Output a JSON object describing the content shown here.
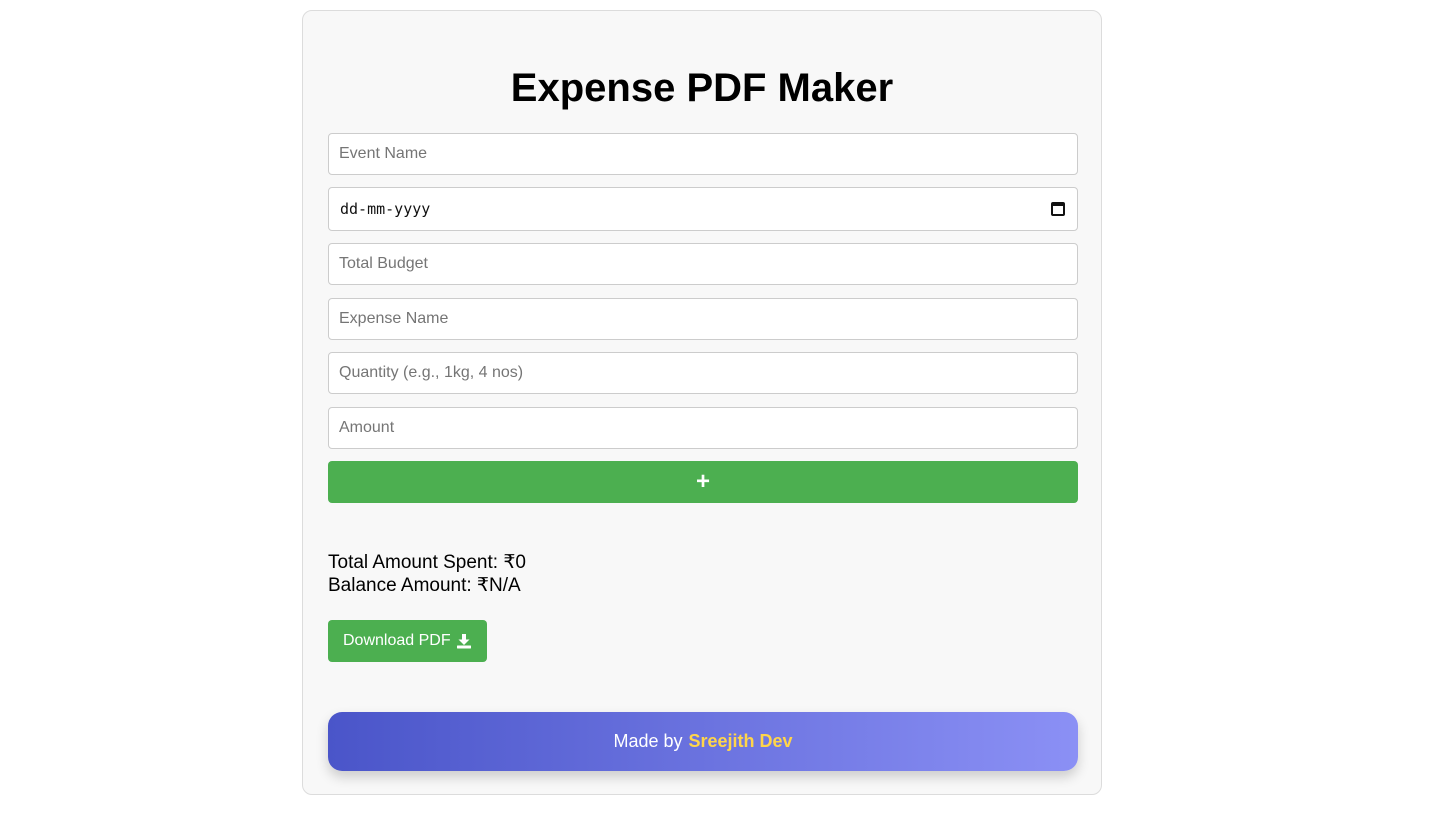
{
  "app": {
    "title": "Expense PDF Maker"
  },
  "form": {
    "event_name_placeholder": "Event Name",
    "date_placeholder": "dd-mm-yyyy",
    "total_budget_placeholder": "Total Budget",
    "expense_name_placeholder": "Expense Name",
    "quantity_placeholder": "Quantity (e.g., 1kg, 4 nos)",
    "amount_placeholder": "Amount",
    "add_button_label": "+"
  },
  "summary": {
    "total_spent": "Total Amount Spent: ₹0",
    "balance": "Balance Amount: ₹N/A"
  },
  "download": {
    "label": "Download PDF",
    "icon": "download-icon"
  },
  "footer": {
    "made_by": "Made by",
    "author": "Sreejith Dev"
  },
  "colors": {
    "accent_green": "#4caf50",
    "footer_gradient_start": "#4a55c9",
    "footer_gradient_end": "#8b90f5",
    "author_yellow": "#ffd54a"
  }
}
